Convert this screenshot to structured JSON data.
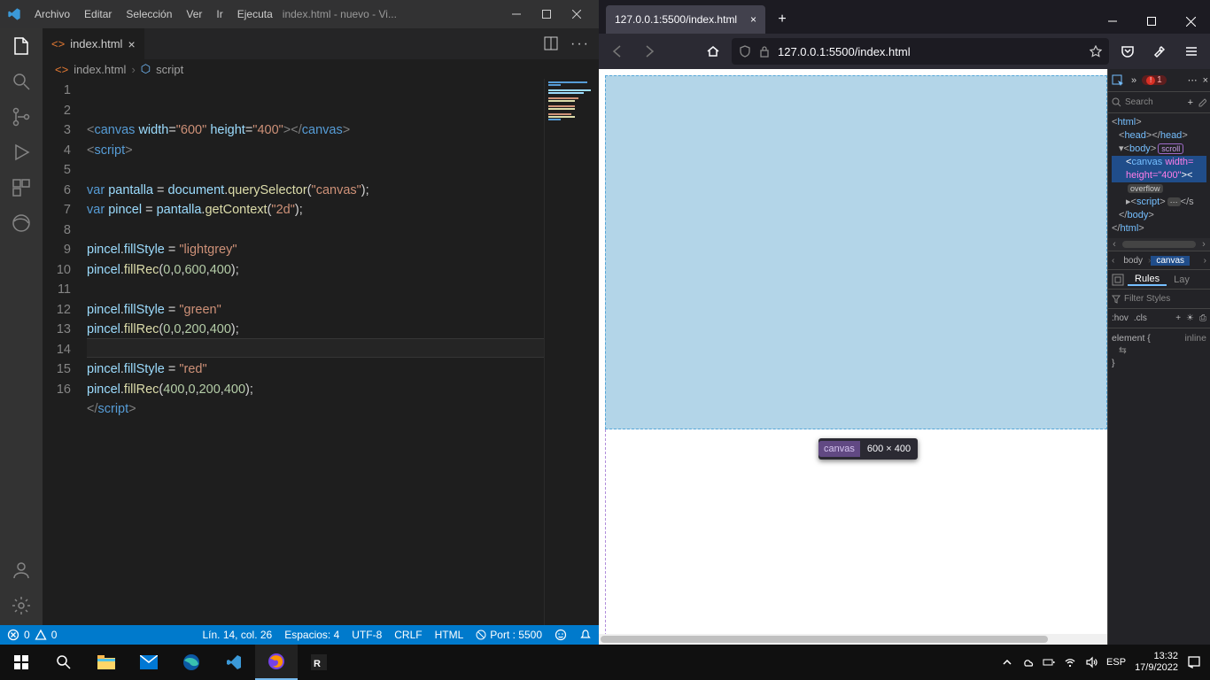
{
  "vscode": {
    "menu": [
      "Archivo",
      "Editar",
      "Selección",
      "Ver",
      "Ir",
      "Ejecuta"
    ],
    "window_title": "index.html - nuevo - Vi...",
    "tab": {
      "label": "index.html"
    },
    "breadcrumb": {
      "file": "index.html",
      "symbol": "script"
    },
    "code_lines": [
      "<canvas width=\"600\" height=\"400\"></canvas>",
      "<script>",
      "",
      "var pantalla = document.querySelector(\"canvas\");",
      "var pincel = pantalla.getContext(\"2d\");",
      "",
      "pincel.fillStyle = \"lightgrey\"",
      "pincel.fillRec(0,0,600,400);",
      "",
      "pincel.fillStyle = \"green\"",
      "pincel.fillRec(0,0,200,400);",
      "",
      "pincel.fillStyle = \"red\"",
      "pincel.fillRec(400,0,200,400);",
      "</script>",
      ""
    ],
    "statusbar": {
      "errors": "0",
      "warnings": "0",
      "position": "Lín. 14, col. 26",
      "spaces": "Espacios: 4",
      "encoding": "UTF-8",
      "eol": "CRLF",
      "lang": "HTML",
      "port": "Port : 5500"
    }
  },
  "firefox": {
    "tab_title": "127.0.0.1:5500/index.html",
    "url": "127.0.0.1:5500/index.html",
    "tooltip": {
      "tag": "canvas",
      "dims": "600 × 400"
    },
    "devtools": {
      "error_count": "1",
      "search_placeholder": "Search",
      "tree": {
        "html": "html",
        "head": "head",
        "body": "body",
        "scroll_badge": "scroll",
        "canvas_open": "canvas",
        "width_attr": "width=",
        "height_attr": "height=\"400\"",
        "overflow_badge": "overflow",
        "script": "script",
        "body_close": "body",
        "html_close": "html"
      },
      "breadcrumb": {
        "body": "body",
        "canvas": "canvas"
      },
      "rules_tab": "Rules",
      "layout_tab": "Lay",
      "filter_placeholder": "Filter Styles",
      "hov": ":hov",
      "cls": ".cls",
      "element_rule": "element {",
      "inline": "inline",
      "brace": "}"
    }
  },
  "taskbar": {
    "lang": "ESP",
    "time": "13:32",
    "date": "17/9/2022"
  }
}
